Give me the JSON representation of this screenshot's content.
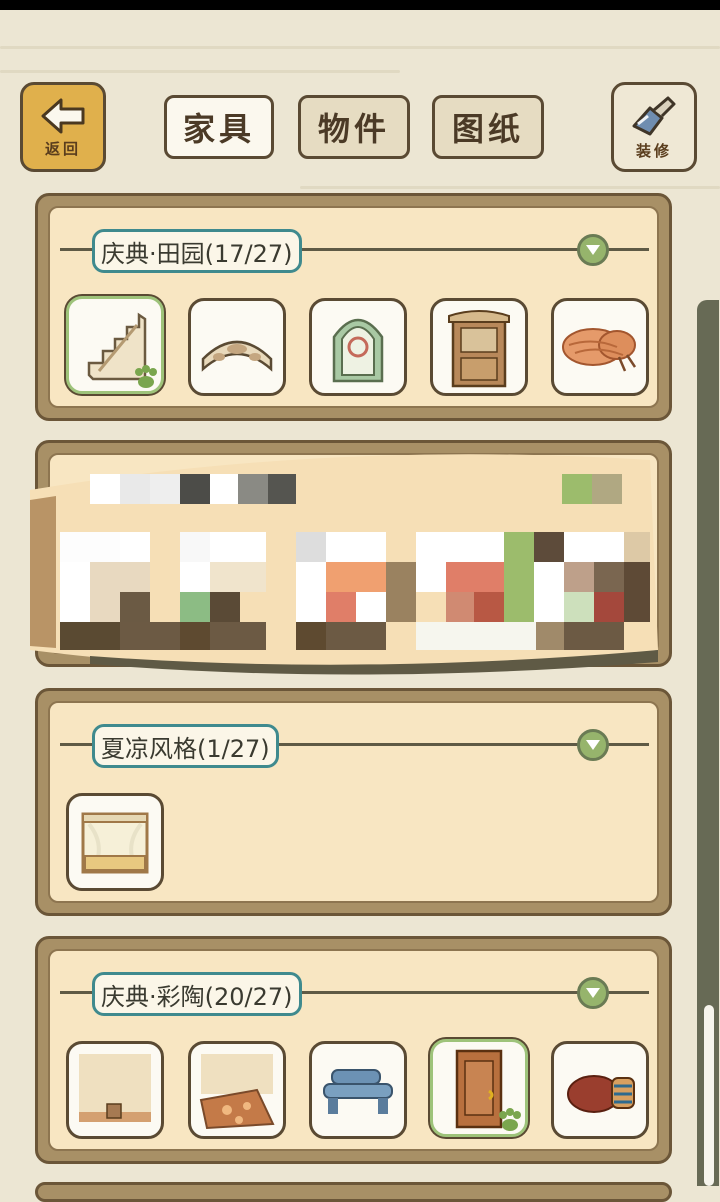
{
  "header": {
    "back_label": "返回",
    "decorate_label": "装修",
    "tabs": [
      {
        "label": "家具",
        "active": true
      },
      {
        "label": "物件",
        "active": false
      },
      {
        "label": "图纸",
        "active": false
      }
    ]
  },
  "sections": [
    {
      "title": "庆典·田园(17/27)",
      "items": [
        {
          "icon": "staircase-icon",
          "owned": true
        },
        {
          "icon": "wooden-bridge-icon",
          "owned": false
        },
        {
          "icon": "arched-window-icon",
          "owned": false
        },
        {
          "icon": "wooden-door-icon",
          "owned": false
        },
        {
          "icon": "rope-bundle-icon",
          "owned": false
        }
      ]
    },
    {
      "title": "",
      "items": []
    },
    {
      "title": "夏凉风格(1/27)",
      "items": [
        {
          "icon": "canopy-bed-icon",
          "owned": false
        }
      ]
    },
    {
      "title": "庆典·彩陶(20/27)",
      "items": [
        {
          "icon": "wall-panel-icon",
          "owned": false
        },
        {
          "icon": "floral-rug-icon",
          "owned": false
        },
        {
          "icon": "blue-bench-icon",
          "owned": false
        },
        {
          "icon": "brown-door-icon",
          "owned": true
        },
        {
          "icon": "clay-pot-icon",
          "owned": false
        }
      ]
    }
  ],
  "colors": {
    "background": "#ece6d3",
    "panel_frame": "#a89066",
    "panel_inner": "#f8e6c2",
    "label_border": "#3f8a8e",
    "toggle_green": "#96b46c",
    "owned_border": "#9ec37a"
  }
}
